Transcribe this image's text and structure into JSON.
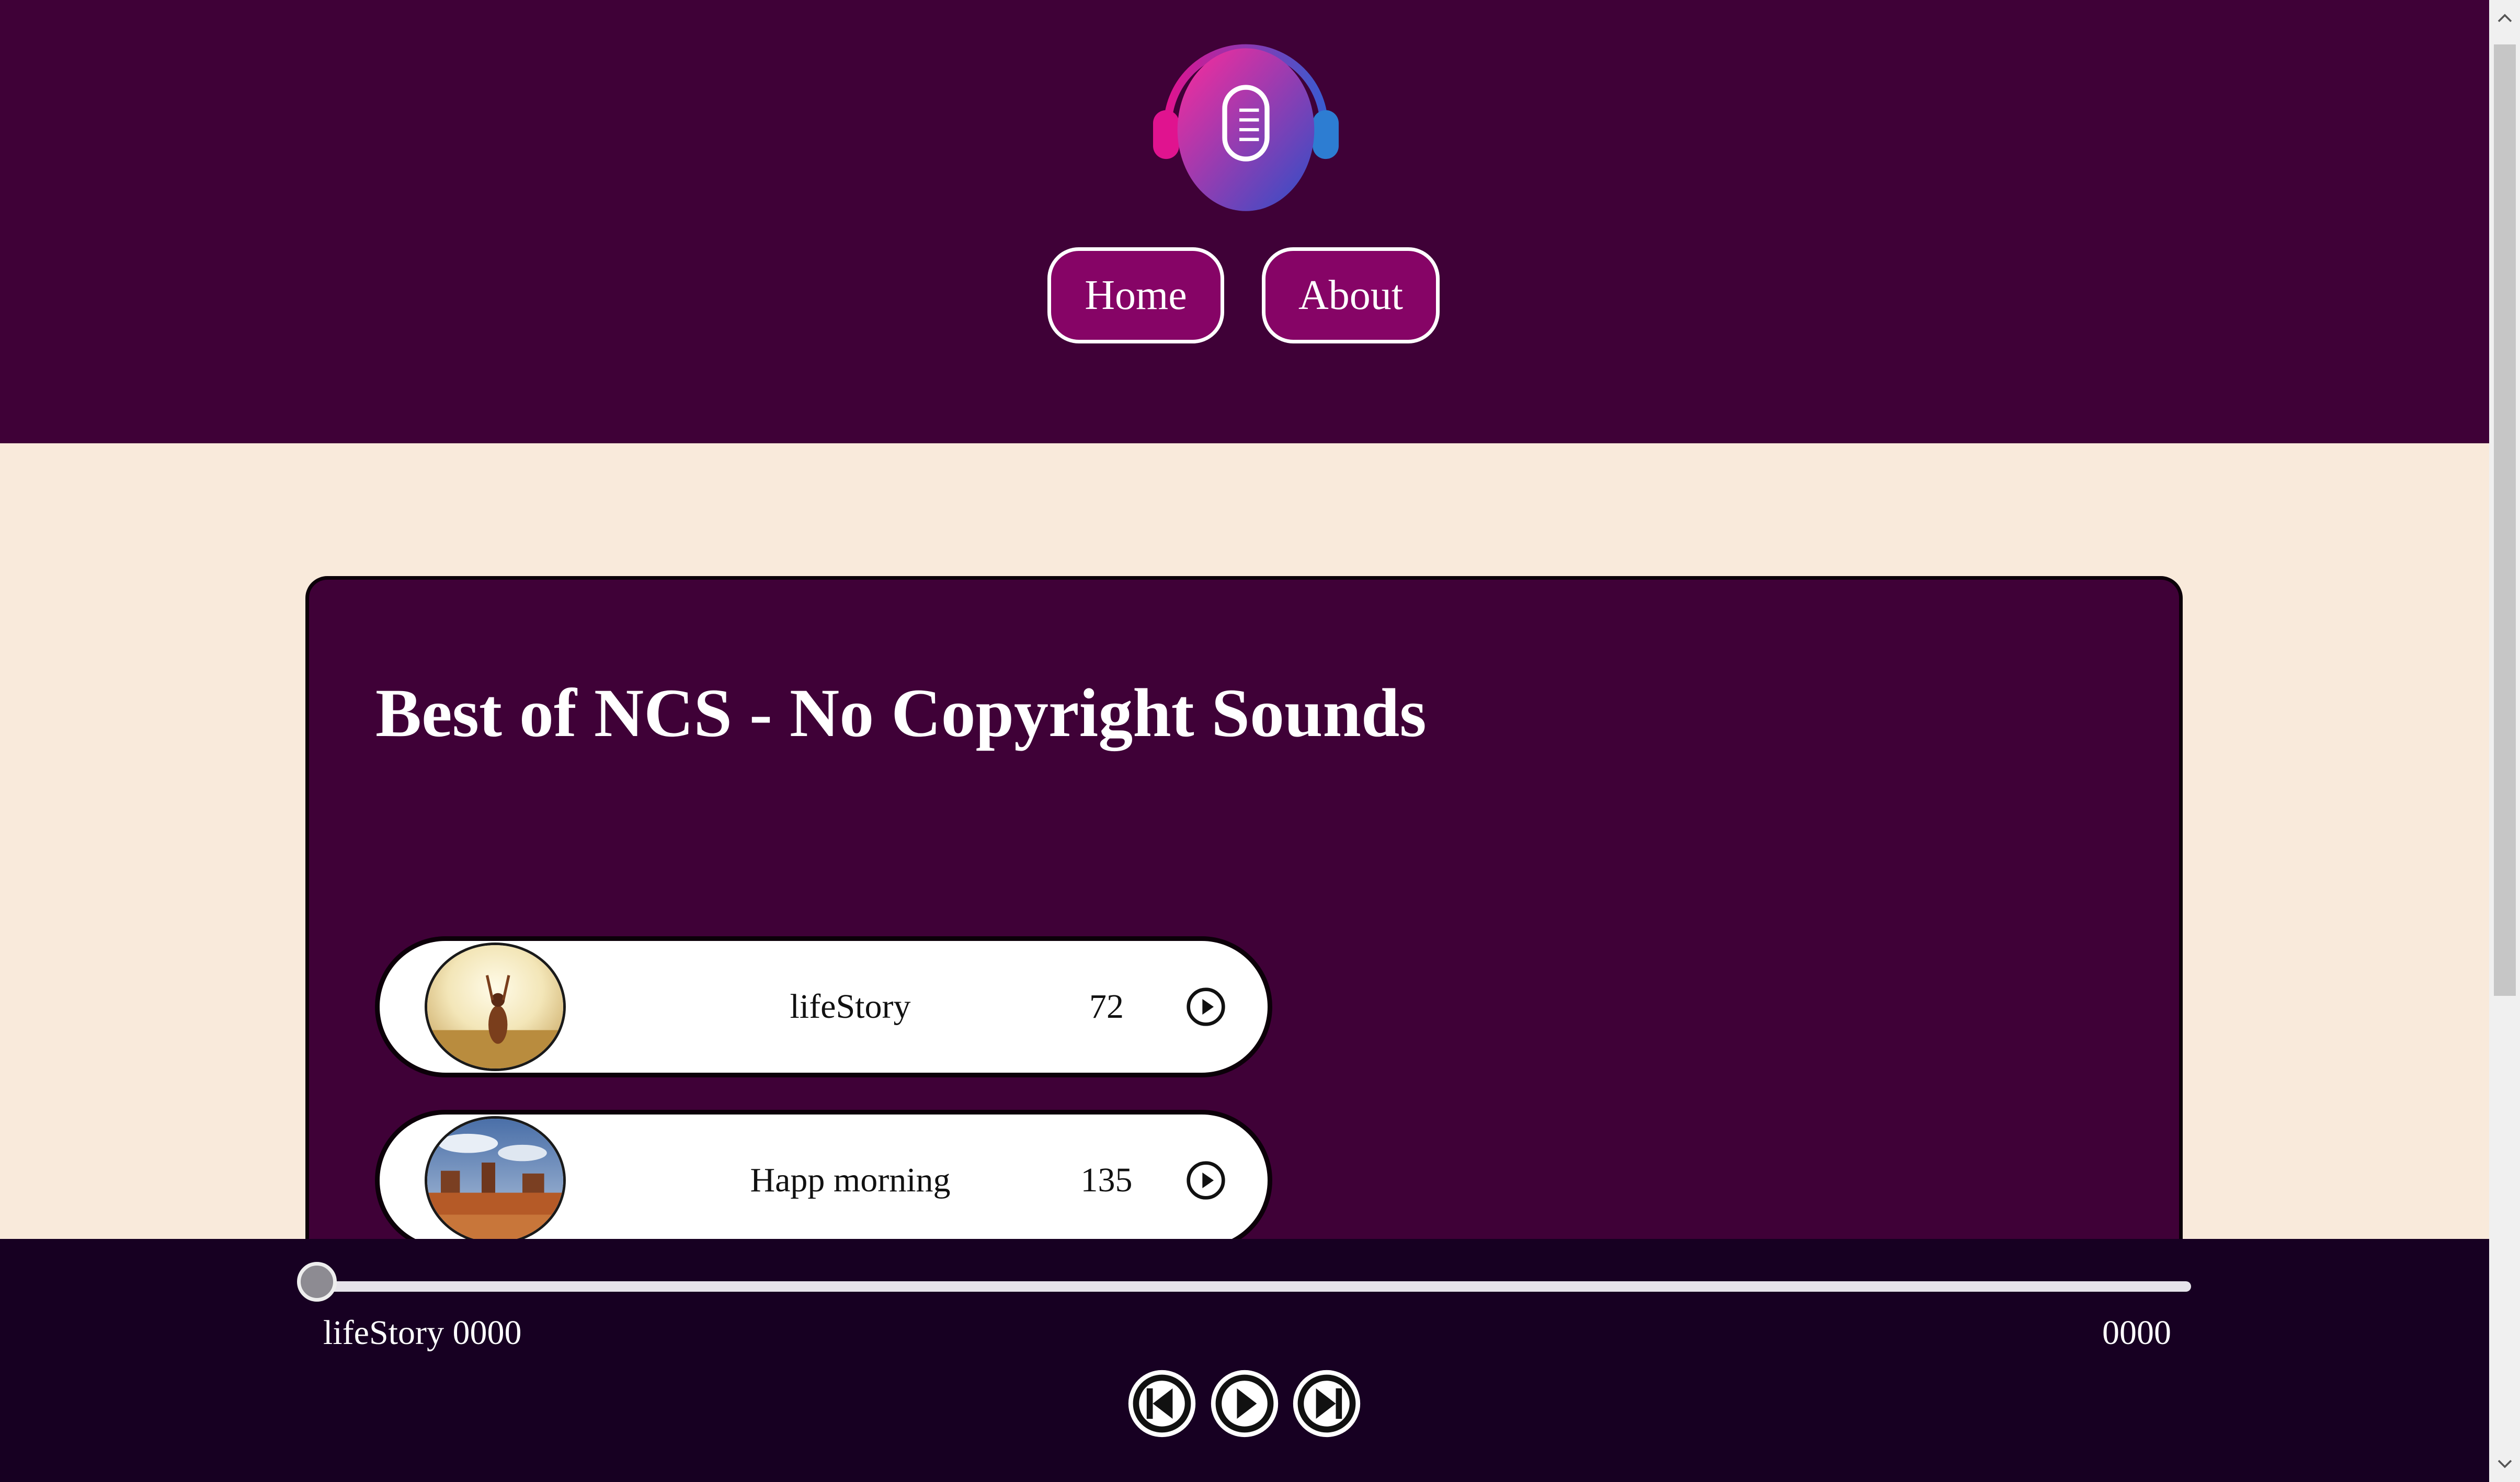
{
  "header": {
    "logo": "podcast-microphone-headphones-logo",
    "nav": [
      {
        "label": "Home"
      },
      {
        "label": "About"
      }
    ]
  },
  "main": {
    "title": "Best of NCS - No Copyright Sounds",
    "songs": [
      {
        "name": "lifeStory",
        "count": "72",
        "thumbnail": "woman-in-field-sunlight-image"
      },
      {
        "name": "Happ morning",
        "count": "135",
        "thumbnail": "desert-mesa-landscape-image"
      }
    ]
  },
  "player": {
    "current_title": "lifeStory 0000",
    "total_time": "0000",
    "progress": 0,
    "controls": [
      "previous-icon",
      "play-icon",
      "next-icon"
    ]
  },
  "colors": {
    "header_bg": "#3f0137",
    "page_bg": "#f9eadb",
    "nav_button": "#860466",
    "player_bg": "#170022"
  }
}
